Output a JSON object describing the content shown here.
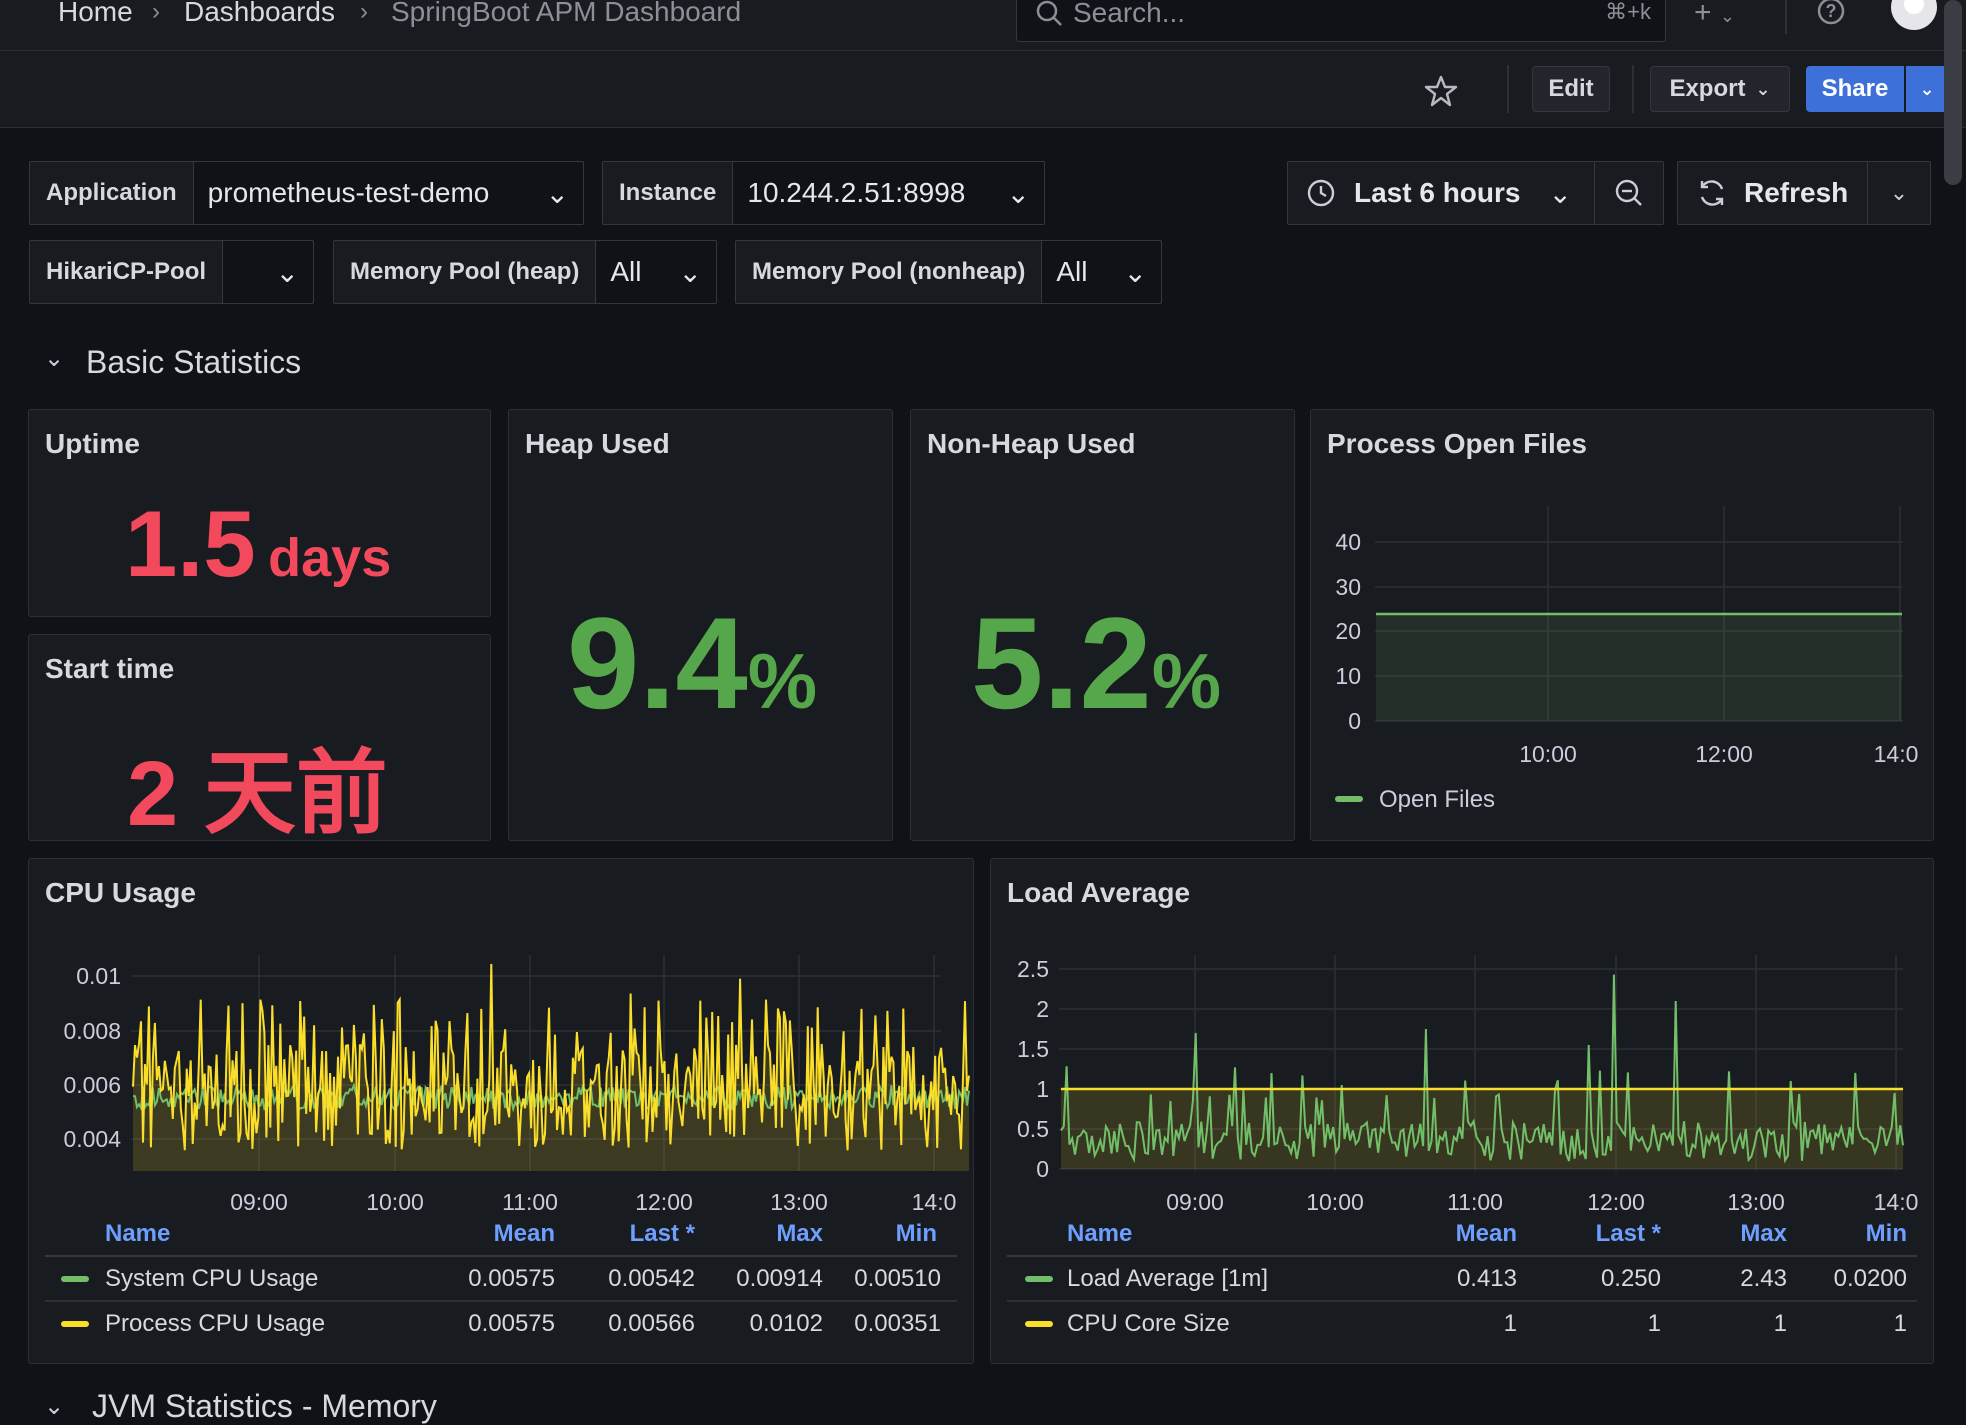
{
  "breadcrumb": {
    "home": "Home",
    "dashboards": "Dashboards",
    "current": "SpringBoot APM Dashboard"
  },
  "search": {
    "placeholder": "Search...",
    "shortcut": "⌘+k"
  },
  "toolbar": {
    "edit": "Edit",
    "export": "Export",
    "share": "Share"
  },
  "variables": {
    "application": {
      "label": "Application",
      "value": "prometheus-test-demo"
    },
    "instance": {
      "label": "Instance",
      "value": "10.244.2.51:8998"
    },
    "hikari": {
      "label": "HikariCP-Pool",
      "value": ""
    },
    "heap_pool": {
      "label": "Memory Pool (heap)",
      "value": "All"
    },
    "nonheap_pool": {
      "label": "Memory Pool (nonheap)",
      "value": "All"
    }
  },
  "timepicker": {
    "range": "Last 6 hours",
    "refresh": "Refresh"
  },
  "rows": {
    "basic": "Basic Statistics",
    "jvm_memory": "JVM Statistics - Memory"
  },
  "panels": {
    "uptime": {
      "title": "Uptime",
      "value": "1.5",
      "unit": "days"
    },
    "start_time": {
      "title": "Start time",
      "value": "2 天前"
    },
    "heap": {
      "title": "Heap Used",
      "value": "9.4",
      "unit": "%"
    },
    "nonheap": {
      "title": "Non-Heap Used",
      "value": "5.2",
      "unit": "%"
    },
    "open_files": {
      "title": "Process Open Files",
      "legend": "Open Files"
    },
    "cpu": {
      "title": "CPU Usage",
      "columns": [
        "Name",
        "Mean",
        "Last *",
        "Max",
        "Min"
      ],
      "rows": [
        [
          "System CPU Usage",
          "0.00575",
          "0.00542",
          "0.00914",
          "0.00510"
        ],
        [
          "Process CPU Usage",
          "0.00575",
          "0.00566",
          "0.0102",
          "0.00351"
        ]
      ]
    },
    "load": {
      "title": "Load Average",
      "columns": [
        "Name",
        "Mean",
        "Last *",
        "Max",
        "Min"
      ],
      "rows": [
        [
          "Load Average [1m]",
          "0.413",
          "0.250",
          "2.43",
          "0.0200"
        ],
        [
          "CPU Core Size",
          "1",
          "1",
          "1",
          "1"
        ]
      ]
    }
  },
  "colors": {
    "red": "#f2495c",
    "green": "#56a64b",
    "green_line": "#73bf69",
    "yellow": "#fade2a",
    "blue": "#3d71d9",
    "link": "#6e9fff"
  },
  "chart_data": [
    {
      "type": "area",
      "title": "Process Open Files",
      "x": [
        "08:30",
        "14:00"
      ],
      "series": [
        {
          "name": "Open Files",
          "values": [
            24,
            24
          ]
        }
      ],
      "yticks": [
        "0",
        "10",
        "20",
        "30",
        "40"
      ],
      "xticks": [
        "10:00",
        "12:00",
        "14:0"
      ],
      "ylim": [
        0,
        45
      ]
    },
    {
      "type": "line",
      "title": "CPU Usage",
      "yticks": [
        "0.004",
        "0.006",
        "0.008",
        "0.01"
      ],
      "xticks": [
        "09:00",
        "10:00",
        "11:00",
        "12:00",
        "13:00",
        "14:0"
      ],
      "ylim": [
        0.0032,
        0.0105
      ],
      "series": [
        {
          "name": "System CPU Usage",
          "mean": 0.00575
        },
        {
          "name": "Process CPU Usage",
          "mean": 0.00575,
          "min": 0.00351,
          "max": 0.0102
        }
      ]
    },
    {
      "type": "line",
      "title": "Load Average",
      "yticks": [
        "0",
        "0.5",
        "1",
        "1.5",
        "2",
        "2.5"
      ],
      "xticks": [
        "09:00",
        "10:00",
        "11:00",
        "12:00",
        "13:00",
        "14:0"
      ],
      "ylim": [
        0,
        2.6
      ],
      "series": [
        {
          "name": "Load Average [1m]",
          "mean": 0.413,
          "min": 0.02,
          "max": 2.43
        },
        {
          "name": "CPU Core Size",
          "values": [
            1,
            1
          ]
        }
      ]
    }
  ]
}
